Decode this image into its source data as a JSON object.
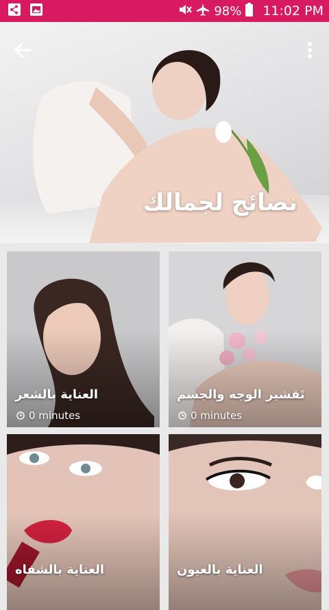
{
  "status_bar": {
    "battery_text": "98%",
    "time": "11:02 PM",
    "icons": [
      "share-icon",
      "image-icon",
      "mute-icon",
      "airplane-icon",
      "battery-icon"
    ]
  },
  "header": {
    "title": "نصائح لجمالك",
    "back_icon": "arrow-left-icon",
    "menu_icon": "more-vertical-icon"
  },
  "cards": [
    {
      "title": "العناية بالشعر",
      "meta": "0 minutes"
    },
    {
      "title": "تَقشير الوجه والجسم",
      "meta": "0 minutes"
    },
    {
      "title": "العناية بالشفاه"
    },
    {
      "title": "العناية بالعيون"
    }
  ],
  "colors": {
    "accent": "#d81b60"
  }
}
